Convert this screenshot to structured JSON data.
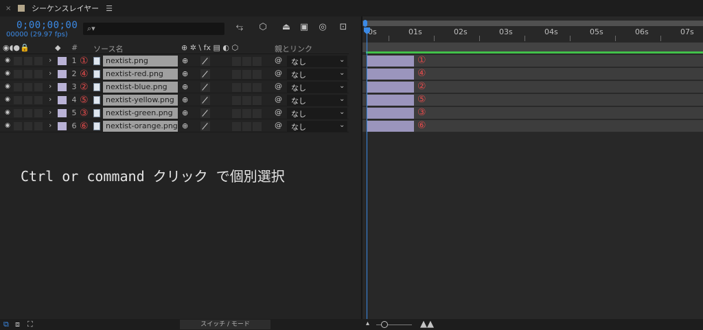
{
  "tab": {
    "close": "×",
    "title": "シーケンスレイヤー",
    "menu": "☰"
  },
  "time": {
    "timecode": "0;00;00;00",
    "frames": "00000 (29.97 fps)"
  },
  "search": {
    "icon": "search-icon",
    "glyph": "⌕▾"
  },
  "tools": [
    "⥃",
    "⬡",
    "⏏",
    "▣",
    "◎",
    "⊡"
  ],
  "columns": {
    "num": "#",
    "source": "ソース名",
    "switches": "⊕ ✲ \\ fx ▤ ◐ ⬡",
    "parent": "親とリンク"
  },
  "layers": [
    {
      "num": "1",
      "circle": "①",
      "name": "nextist.png",
      "parent": "なし"
    },
    {
      "num": "2",
      "circle": "④",
      "name": "nextist-red.png",
      "parent": "なし"
    },
    {
      "num": "3",
      "circle": "②",
      "name": "nextist-blue.png",
      "parent": "なし"
    },
    {
      "num": "4",
      "circle": "⑤",
      "name": "nextist-yellow.png",
      "parent": "なし"
    },
    {
      "num": "5",
      "circle": "③",
      "name": "nextist-green.png",
      "parent": "なし"
    },
    {
      "num": "6",
      "circle": "⑥",
      "name": "nextist-orange.png",
      "parent": "なし"
    }
  ],
  "caption": "Ctrl or command クリック で個別選択",
  "ruler": [
    "0s",
    "01s",
    "02s",
    "03s",
    "04s",
    "05s",
    "06s",
    "07s"
  ],
  "bottom": {
    "switch_label": "スイッチ / モード"
  },
  "colors": {
    "accent": "#3b8ae6",
    "label": "#b9b2d6",
    "marker": "#e24b4b",
    "workarea": "#42c14a"
  }
}
